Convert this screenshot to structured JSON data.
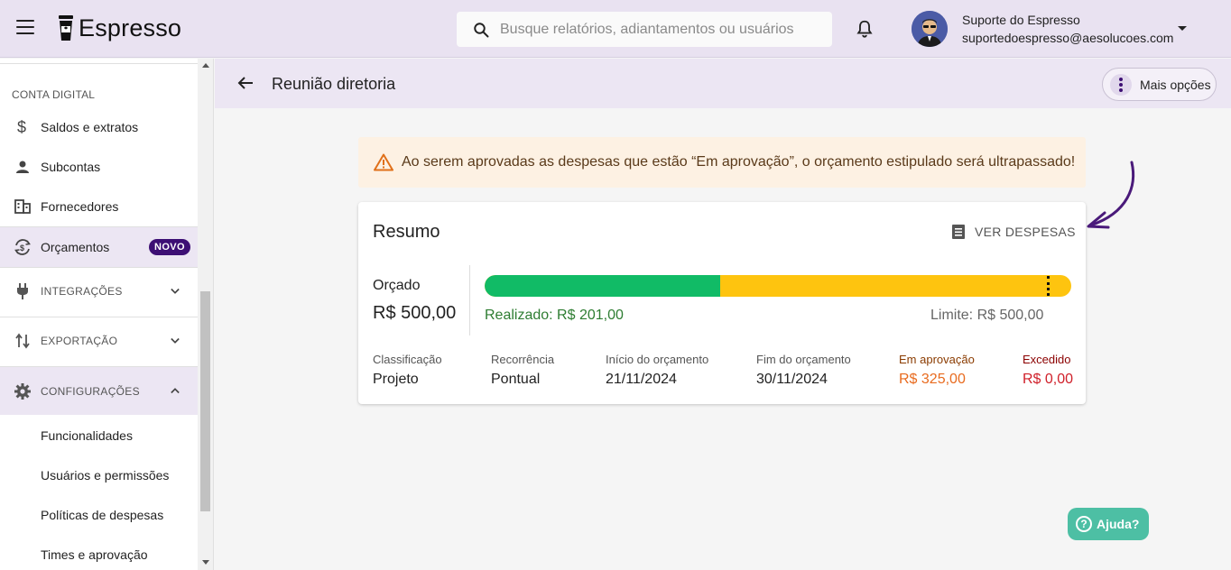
{
  "app": {
    "name": "Espresso"
  },
  "search": {
    "placeholder": "Busque relatórios, adiantamentos ou usuários"
  },
  "user": {
    "name": "Suporte do Espresso",
    "email": "suportedoespresso@aesolucoes.com"
  },
  "sidebar": {
    "section_label": "CONTA DIGITAL",
    "items": [
      {
        "label": "Saldos e extratos",
        "icon": "dollar-icon"
      },
      {
        "label": "Subcontas",
        "icon": "person-icon"
      },
      {
        "label": "Fornecedores",
        "icon": "building-icon"
      },
      {
        "label": "Orçamentos",
        "icon": "budget-icon",
        "badge": "NOVO"
      },
      {
        "label": "INTEGRAÇÕES",
        "icon": "plug-icon"
      },
      {
        "label": "EXPORTAÇÃO",
        "icon": "sort-arrows-icon"
      },
      {
        "label": "CONFIGURAÇÕES",
        "icon": "gear-icon"
      }
    ],
    "sub_items": [
      {
        "label": "Funcionalidades"
      },
      {
        "label": "Usuários e permissões"
      },
      {
        "label": "Políticas de despesas"
      },
      {
        "label": "Times e aprovação"
      }
    ]
  },
  "page": {
    "title": "Reunião diretoria",
    "more_options_label": "Mais opções"
  },
  "alert": {
    "text": "Ao serem aprovadas as despesas que estão “Em aprovação”, o orçamento estipulado será ultrapassado!"
  },
  "summary": {
    "title": "Resumo",
    "ver_despesas_label": "VER DESPESAS",
    "orcado_label": "Orçado",
    "orcado_value": "R$ 500,00",
    "realizado_text": "Realizado: R$ 201,00",
    "limite_text": "Limite: R$ 500,00",
    "progress": {
      "realizado_fraction": 0.402,
      "limit_fraction": 0.958
    },
    "colors": {
      "realizado": "#11bb66",
      "em_aprovacao": "#fec40f",
      "badge": "#3d0f74",
      "help": "#4dbfa4"
    },
    "stats": [
      {
        "label": "Classificação",
        "value": "Projeto"
      },
      {
        "label": "Recorrência",
        "value": "Pontual"
      },
      {
        "label": "Início do orçamento",
        "value": "21/11/2024"
      },
      {
        "label": "Fim do orçamento",
        "value": "30/11/2024"
      },
      {
        "label": "Em aprovação",
        "value": "R$ 325,00"
      },
      {
        "label": "Excedido",
        "value": "R$ 0,00"
      }
    ]
  },
  "help": {
    "label": "Ajuda?"
  }
}
